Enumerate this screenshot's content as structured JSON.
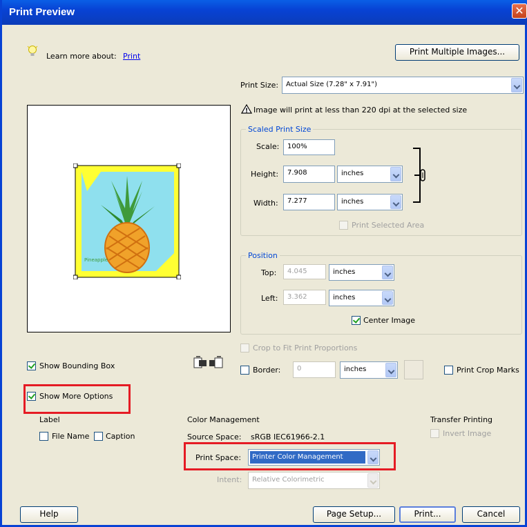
{
  "window": {
    "title": "Print Preview"
  },
  "learn_more": {
    "prefix": "Learn more about:",
    "link": "Print"
  },
  "print_multiple_button": "Print Multiple Images...",
  "print_size": {
    "label": "Print Size:",
    "value": "Actual Size (7.28\" x 7.91\")"
  },
  "warning": "Image will print at less than 220 dpi at the selected size",
  "preview": {
    "image_caption": "Pineapple"
  },
  "scaled_print_size": {
    "legend": "Scaled Print Size",
    "scale_label": "Scale:",
    "scale_value": "100%",
    "height_label": "Height:",
    "height_value": "7.908",
    "height_unit": "inches",
    "width_label": "Width:",
    "width_value": "7.277",
    "width_unit": "inches",
    "print_selected_area": "Print Selected Area"
  },
  "position": {
    "legend": "Position",
    "top_label": "Top:",
    "top_value": "4.045",
    "top_unit": "inches",
    "left_label": "Left:",
    "left_value": "3.362",
    "left_unit": "inches",
    "center_image": "Center Image"
  },
  "crop_to_fit": "Crop to Fit Print Proportions",
  "show_bounding_box": "Show Bounding Box",
  "border": {
    "label": "Border:",
    "value": "0",
    "unit": "inches"
  },
  "print_crop_marks": "Print Crop Marks",
  "show_more_options": "Show More Options",
  "label_section": {
    "heading": "Label",
    "file_name": "File Name",
    "caption": "Caption"
  },
  "color_management": {
    "heading": "Color Management",
    "source_space_label": "Source Space:",
    "source_space_value": "sRGB IEC61966-2.1",
    "print_space_label": "Print Space:",
    "print_space_value": "Printer Color Management",
    "intent_label": "Intent:",
    "intent_value": "Relative Colorimetric"
  },
  "transfer_printing": {
    "heading": "Transfer Printing",
    "invert_image": "Invert Image"
  },
  "buttons": {
    "help": "Help",
    "page_setup": "Page Setup...",
    "print": "Print...",
    "cancel": "Cancel"
  },
  "colors": {
    "accent_title": "#0842d4",
    "highlight_box": "#e51b24",
    "group_legend": "#0046d5"
  }
}
